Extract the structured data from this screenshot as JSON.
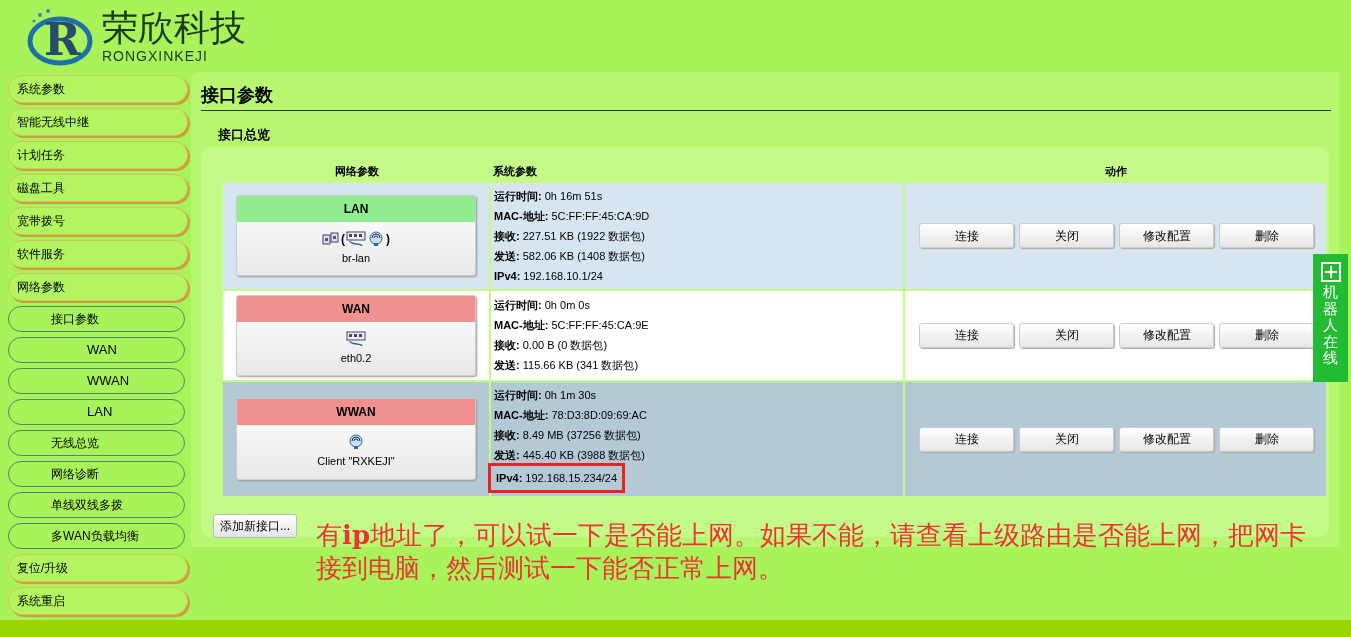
{
  "logo": {
    "mark": "R",
    "name": "荣欣科技",
    "subtitle": "RONGXINKEJI"
  },
  "sidebar": {
    "items": [
      {
        "label": "系统参数"
      },
      {
        "label": "智能无线中继"
      },
      {
        "label": "计划任务"
      },
      {
        "label": "磁盘工具"
      },
      {
        "label": "宽带拨号"
      },
      {
        "label": "软件服务"
      },
      {
        "label": "网络参数",
        "children": [
          {
            "label": "接口参数",
            "children": [
              {
                "label": "WAN"
              },
              {
                "label": "WWAN"
              },
              {
                "label": "LAN"
              }
            ]
          },
          {
            "label": "无线总览"
          },
          {
            "label": "网络诊断"
          },
          {
            "label": "单线双线多拨"
          },
          {
            "label": "多WAN负载均衡"
          }
        ]
      },
      {
        "label": "复位/升级"
      },
      {
        "label": "系统重启"
      }
    ]
  },
  "page_title": "接口参数",
  "section_title": "接口总览",
  "table": {
    "columns": [
      "网络参数",
      "系统参数",
      "动作"
    ],
    "rows": [
      {
        "name": "LAN",
        "color": "#90ee90",
        "highlighted": false,
        "device": "br-lan",
        "icons": [
          {
            "kind": "port"
          },
          {
            "kind": "text",
            "text": "("
          },
          {
            "kind": "switch"
          },
          {
            "kind": "wireless"
          },
          {
            "kind": "text",
            "text": ")"
          }
        ],
        "stats": [
          {
            "label": "运行时间:",
            "value": "0h 16m 51s",
            "highlighted": false
          },
          {
            "label": "MAC-地址:",
            "value": "5C:FF:FF:45:CA:9D",
            "highlighted": false
          },
          {
            "label": "接收:",
            "value": "227.51 KB (1922 数据包)",
            "highlighted": false
          },
          {
            "label": "发送:",
            "value": "582.06 KB (1408 数据包)",
            "highlighted": false
          },
          {
            "label": "IPv4:",
            "value": "192.168.10.1/24",
            "highlighted": false
          }
        ],
        "actions": [
          "连接",
          "关闭",
          "修改配置",
          "删除"
        ]
      },
      {
        "name": "WAN",
        "color": "#f09090",
        "highlighted": false,
        "device": "eth0.2",
        "icons": [
          {
            "kind": "switch"
          }
        ],
        "stats": [
          {
            "label": "运行时间:",
            "value": "0h 0m 0s",
            "highlighted": false
          },
          {
            "label": "MAC-地址:",
            "value": "5C:FF:FF:45:CA:9E",
            "highlighted": false
          },
          {
            "label": "接收:",
            "value": "0.00 B (0 数据包)",
            "highlighted": false
          },
          {
            "label": "发送:",
            "value": "115.66 KB (341 数据包)",
            "highlighted": false
          }
        ],
        "actions": [
          "连接",
          "关闭",
          "修改配置",
          "删除"
        ]
      },
      {
        "name": "WWAN",
        "color": "#f09090",
        "highlighted": true,
        "device": "Client \"RXKEJI\"",
        "icons": [
          {
            "kind": "wireless"
          }
        ],
        "stats": [
          {
            "label": "运行时间:",
            "value": "0h 1m 30s",
            "highlighted": false
          },
          {
            "label": "MAC-地址:",
            "value": "78:D3:8D:09:69:AC",
            "highlighted": false
          },
          {
            "label": "接收:",
            "value": "8.49 MB (37256 数据包)",
            "highlighted": false
          },
          {
            "label": "发送:",
            "value": "445.40 KB (3988 数据包)",
            "highlighted": false
          },
          {
            "label": "IPv4:",
            "value": "192.168.15.234/24",
            "highlighted": true
          }
        ],
        "actions": [
          "连接",
          "关闭",
          "修改配置",
          "删除"
        ]
      }
    ]
  },
  "add_button": "添加新接口...",
  "annotation": "有**ip**地址了，可以试一下是否能上网。如果不能，请查看上级路由是否能上网，把网卡接到电脑，然后测试一下能否正常上网。",
  "side_tab": {
    "label": "机器人在线"
  }
}
